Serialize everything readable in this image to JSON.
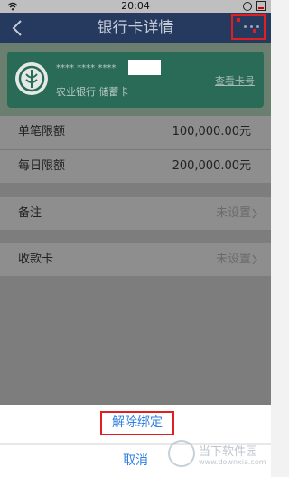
{
  "status_bar": {
    "time": "20:04"
  },
  "nav": {
    "title": "银行卡详情"
  },
  "card": {
    "masked_number": "**** **** ****",
    "bank_type": "农业银行 储蓄卡",
    "view_number_label": "查看卡号"
  },
  "limits": [
    {
      "label": "单笔限额",
      "value": "100,000.00元"
    },
    {
      "label": "每日限额",
      "value": "200,000.00元"
    }
  ],
  "remark": {
    "label": "备注",
    "value": "未设置"
  },
  "receiving_card": {
    "label": "收款卡",
    "value": "未设置"
  },
  "action_sheet": {
    "unbind_label": "解除绑定",
    "cancel_label": "取消"
  },
  "watermark": {
    "text": "当下软件园",
    "url": "www.downxia.com"
  },
  "colors": {
    "nav_bg": "#253a5e",
    "card_bg": "#2a6b58",
    "action_text": "#2f7fe0",
    "highlight_box": "#e02020"
  }
}
